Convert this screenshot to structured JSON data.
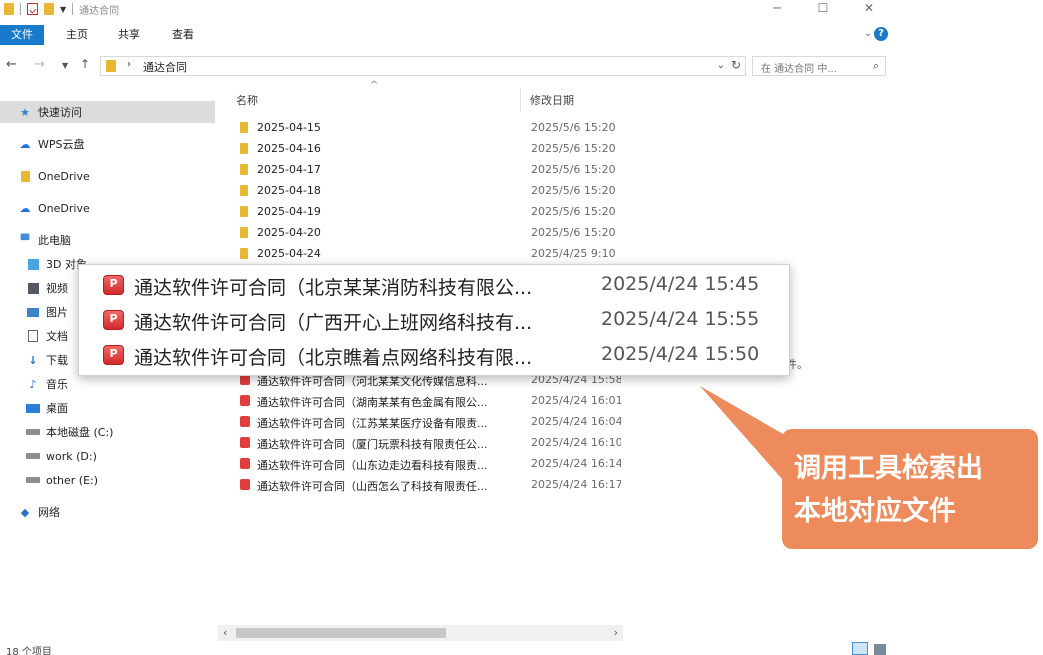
{
  "window": {
    "title": "通达合同",
    "controls": {
      "minimize": "─",
      "maximize": "☐",
      "close": "✕"
    }
  },
  "ribbon": {
    "tabs": [
      "文件",
      "主页",
      "共享",
      "查看"
    ],
    "help": "?"
  },
  "address": {
    "path": "通达合同",
    "search_placeholder": "在 通达合同 中...",
    "back": "←",
    "forward": "→",
    "up": "↑"
  },
  "nav": {
    "items": [
      {
        "label": "快速访问",
        "icon": "star-icon"
      },
      {
        "label": "WPS云盘",
        "icon": "cloud-icon"
      },
      {
        "label": "OneDrive",
        "icon": "folder-icon"
      },
      {
        "label": "OneDrive",
        "icon": "cloud-icon"
      },
      {
        "label": "此电脑",
        "icon": "computer-icon"
      },
      {
        "label": "3D 对象",
        "icon": "3d-objects-icon"
      },
      {
        "label": "视频",
        "icon": "video-icon"
      },
      {
        "label": "图片",
        "icon": "pictures-icon"
      },
      {
        "label": "文档",
        "icon": "documents-icon"
      },
      {
        "label": "下载",
        "icon": "download-icon"
      },
      {
        "label": "音乐",
        "icon": "music-icon"
      },
      {
        "label": "桌面",
        "icon": "desktop-icon"
      },
      {
        "label": "本地磁盘 (C:)",
        "icon": "drive-icon"
      },
      {
        "label": "work (D:)",
        "icon": "drive-icon"
      },
      {
        "label": "other (E:)",
        "icon": "drive-icon"
      },
      {
        "label": "网络",
        "icon": "network-icon"
      }
    ]
  },
  "list": {
    "columns": {
      "name": "名称",
      "date": "修改日期",
      "sort_glyph": "^"
    },
    "rows": [
      {
        "type": "folder",
        "name": "2025-04-15",
        "date": "2025/5/6 15:20"
      },
      {
        "type": "folder",
        "name": "2025-04-16",
        "date": "2025/5/6 15:20"
      },
      {
        "type": "folder",
        "name": "2025-04-17",
        "date": "2025/5/6 15:20"
      },
      {
        "type": "folder",
        "name": "2025-04-18",
        "date": "2025/5/6 15:20"
      },
      {
        "type": "folder",
        "name": "2025-04-19",
        "date": "2025/5/6 15:20"
      },
      {
        "type": "folder",
        "name": "2025-04-20",
        "date": "2025/5/6 15:20"
      },
      {
        "type": "folder",
        "name": "2025-04-24",
        "date": "2025/4/25 9:10"
      },
      {
        "type": "pdf",
        "name": "通达软件许可合同（河北某某文化传媒信息科...",
        "date": "2025/4/24 15:58"
      },
      {
        "type": "pdf",
        "name": "通达软件许可合同（湖南某某有色金属有限公...",
        "date": "2025/4/24 16:01"
      },
      {
        "type": "pdf",
        "name": "通达软件许可合同（江苏某某医疗设备有限责...",
        "date": "2025/4/24 16:04"
      },
      {
        "type": "pdf",
        "name": "通达软件许可合同（厦门玩票科技有限责任公...",
        "date": "2025/4/24 16:10"
      },
      {
        "type": "pdf",
        "name": "通达软件许可合同（山东边走边看科技有限责...",
        "date": "2025/4/24 16:14"
      },
      {
        "type": "pdf",
        "name": "通达软件许可合同（山西怎么了科技有限责任...",
        "date": "2025/4/24 16:17"
      }
    ],
    "hidden_tail": "件。"
  },
  "zoom": {
    "rows": [
      {
        "name": "通达软件许可合同（北京某某消防科技有限公...",
        "date": "2025/4/24 15:45"
      },
      {
        "name": "通达软件许可合同（广西开心上班网络科技有...",
        "date": "2025/4/24 15:55"
      },
      {
        "name": "通达软件许可合同（北京瞧着点网络科技有限...",
        "date": "2025/4/24 15:50"
      }
    ]
  },
  "status": {
    "count": "18 个项目"
  },
  "callout": {
    "lines": [
      "调用工具检索出",
      "本地对应文件"
    ],
    "color": "#ee8b5c"
  },
  "colors": {
    "accent": "#1979ca",
    "folder": "#e8b834",
    "pdf": "#e23d3d"
  }
}
